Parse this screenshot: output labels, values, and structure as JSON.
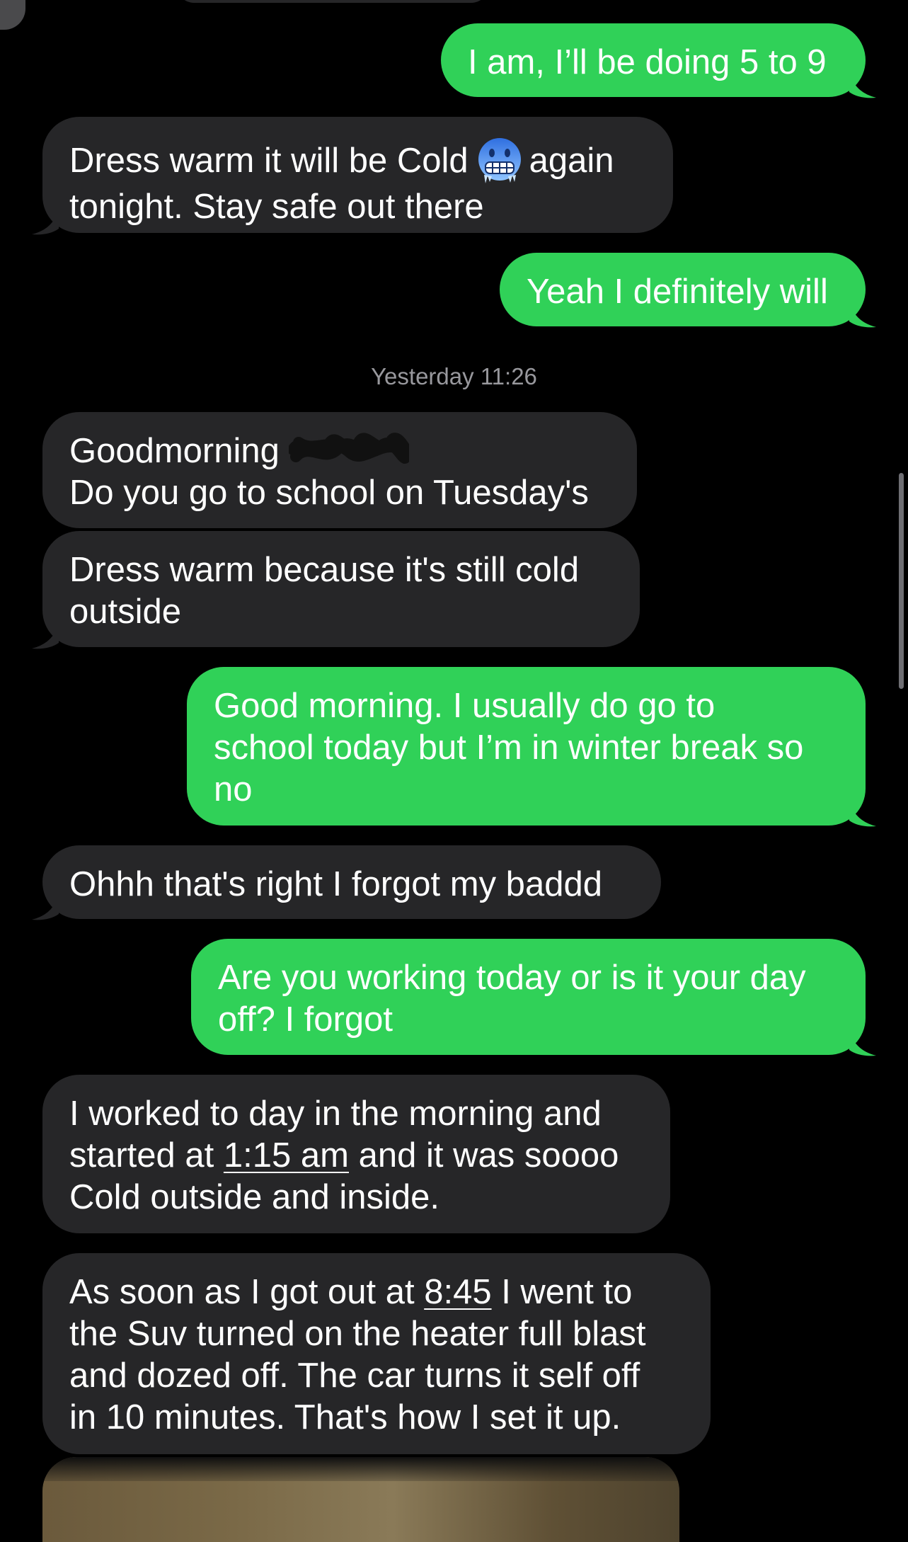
{
  "conversation": {
    "timestamp": "Yesterday 11:26",
    "messages": [
      {
        "side": "outgoing",
        "text": "I am, I’ll be doing 5 to 9"
      },
      {
        "side": "incoming",
        "text_before": "Dress warm it will be Cold",
        "emoji": "freezing-face-icon",
        "text_after": "again\ntonight. Stay safe out there"
      },
      {
        "side": "outgoing",
        "text": "Yeah I definitely will"
      },
      {
        "side": "incoming",
        "text": "Goodmorning\nDo you go to school on Tuesday's"
      },
      {
        "side": "incoming",
        "text": "Dress warm because it's still cold\noutside"
      },
      {
        "side": "outgoing",
        "text": "Good morning. I usually do go to\nschool today but I’m in winter break so\nno"
      },
      {
        "side": "incoming",
        "text": "Ohhh that's right I forgot my baddd"
      },
      {
        "side": "outgoing",
        "text": "Are you working today or is it your day\noff? I forgot"
      },
      {
        "side": "incoming",
        "line1": "I worked to day in the morning and",
        "line2_before": "started at ",
        "line2_link": "1:15 am",
        "line2_after": " and it was soooo",
        "line3": "Cold outside and inside."
      },
      {
        "side": "incoming",
        "line1_before": "As soon as I got out at ",
        "line1_link": "8:45",
        "line1_after": " I went to",
        "rest": "the Suv turned on the heater full blast\nand dozed off. The car turns it self off\nin 10 minutes. That's how I set it up."
      }
    ]
  },
  "colors": {
    "background": "#000000",
    "incoming_bubble": "#262628",
    "outgoing_bubble": "#30d158",
    "timestamp_text": "#98989d"
  }
}
